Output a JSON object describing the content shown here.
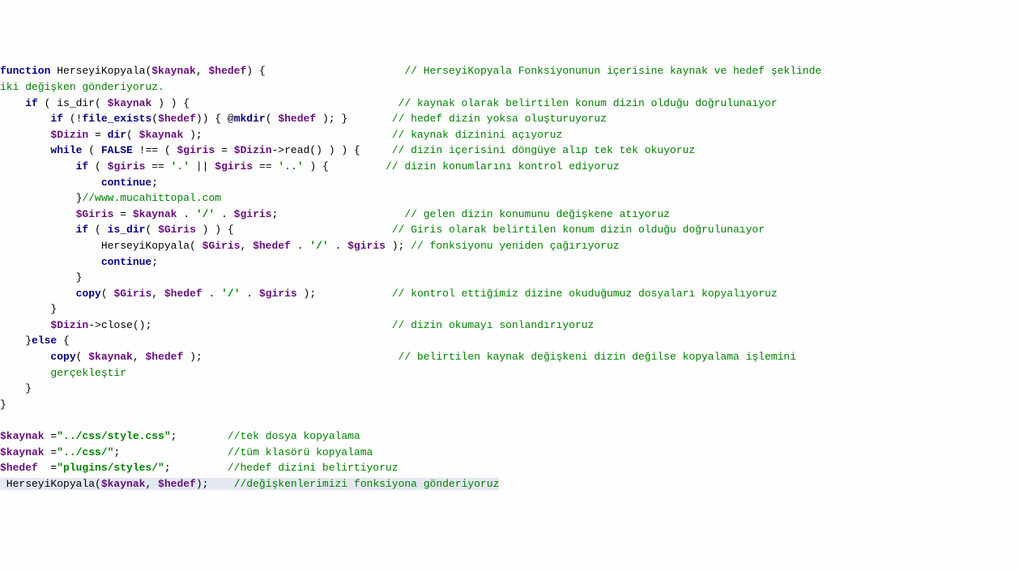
{
  "code": {
    "l1_a": "function",
    "l1_b": " HerseyiKopyala(",
    "l1_c": "$kaynak",
    "l1_d": ", ",
    "l1_e": "$hedef",
    "l1_f": ") {",
    "l1_pad": "                      ",
    "l1_com": "// HerseyiKopyala Fonksiyonunun içerisine kaynak ve hedef şeklinde",
    "l2_a": "iki değişken gönderiyoruz.",
    "l3_pad": "    ",
    "l3_a": "if",
    "l3_b": " ( is_dir( ",
    "l3_c": "$kaynak",
    "l3_d": " ) ) {",
    "l3_pad2": "                                 ",
    "l3_com": "// kaynak olarak belirtilen konum dizin olduğu doğrulunaıyor",
    "l4_pad": "        ",
    "l4_a": "if",
    "l4_b": " (!",
    "l4_c": "file_exists",
    "l4_d": "(",
    "l4_e": "$hedef",
    "l4_f": ")) { @",
    "l4_g": "mkdir",
    "l4_h": "( ",
    "l4_i": "$hedef",
    "l4_j": " ); }",
    "l4_pad2": "       ",
    "l4_com": "// hedef dizin yoksa oluşturuyoruz",
    "l5_pad": "        ",
    "l5_a": "$Dizin",
    "l5_b": " = ",
    "l5_c": "dir",
    "l5_d": "( ",
    "l5_e": "$kaynak",
    "l5_f": " );",
    "l5_pad2": "                              ",
    "l5_com": "// kaynak dizinini açıyoruz",
    "l6_pad": "        ",
    "l6_a": "while",
    "l6_b": " ( ",
    "l6_c": "FALSE",
    "l6_d": " !== ( ",
    "l6_e": "$giris",
    "l6_f": " = ",
    "l6_g": "$Dizin",
    "l6_h": "->read() ) ) {",
    "l6_pad2": "     ",
    "l6_com": "// dizin içerisini döngüye alıp tek tek okuyoruz",
    "l7_pad": "            ",
    "l7_a": "if",
    "l7_b": " ( ",
    "l7_c": "$giris",
    "l7_d": " == ",
    "l7_e": "'.'",
    "l7_f": " || ",
    "l7_g": "$giris",
    "l7_h": " == ",
    "l7_i": "'..'",
    "l7_j": " ) {",
    "l7_pad2": "         ",
    "l7_com": "// dizin konumlarını kontrol ediyoruz",
    "l8_pad": "                ",
    "l8_a": "continue",
    "l8_b": ";",
    "l9_pad": "            ",
    "l9_a": "}",
    "l9_com": "//www.mucahittopal.com",
    "l10_pad": "            ",
    "l10_a": "$Giris",
    "l10_b": " = ",
    "l10_c": "$kaynak",
    "l10_d": " . ",
    "l10_e": "'/'",
    "l10_f": " . ",
    "l10_g": "$giris",
    "l10_h": ";",
    "l10_pad2": "                    ",
    "l10_com": "// gelen dizin konumunu değişkene atıyoruz",
    "l11_pad": "            ",
    "l11_a": "if",
    "l11_b": " ( ",
    "l11_c": "is_dir",
    "l11_d": "( ",
    "l11_e": "$Giris",
    "l11_f": " ) ) {",
    "l11_pad2": "                         ",
    "l11_com": "// Giris olarak belirtilen konum dizin olduğu doğrulunaıyor",
    "l12_pad": "                ",
    "l12_a": "HerseyiKopyala( ",
    "l12_b": "$Giris",
    "l12_c": ", ",
    "l12_d": "$hedef",
    "l12_e": " . ",
    "l12_f": "'/'",
    "l12_g": " . ",
    "l12_h": "$giris",
    "l12_i": " ); ",
    "l12_com": "// fonksiyonu yeniden çağırıyoruz",
    "l13_pad": "                ",
    "l13_a": "continue",
    "l13_b": ";",
    "l14_pad": "            ",
    "l14_a": "}",
    "l15_pad": "            ",
    "l15_a": "copy",
    "l15_b": "( ",
    "l15_c": "$Giris",
    "l15_d": ", ",
    "l15_e": "$hedef",
    "l15_f": " . ",
    "l15_g": "'/'",
    "l15_h": " . ",
    "l15_i": "$giris",
    "l15_j": " );",
    "l15_pad2": "            ",
    "l15_com": "// kontrol ettiğimiz dizine okuduğumuz dosyaları kopyalıyoruz",
    "l16_pad": "        ",
    "l16_a": "}",
    "l17_pad": "        ",
    "l17_a": "$Dizin",
    "l17_b": "->close();",
    "l17_pad2": "                                      ",
    "l17_com": "// dizin okumayı sonlandırıyoruz",
    "l18_pad": "    ",
    "l18_a": "}",
    "l18_b": "else",
    "l18_c": " {",
    "l19_pad": "        ",
    "l19_a": "copy",
    "l19_b": "( ",
    "l19_c": "$kaynak",
    "l19_d": ", ",
    "l19_e": "$hedef",
    "l19_f": " );",
    "l19_pad2": "                               ",
    "l19_com": "// belirtilen kaynak değişkeni dizin değilse kopyalama işlemini",
    "l20_pad": "        ",
    "l20_a": "gerçekleştir",
    "l21_pad": "    ",
    "l21_a": "}",
    "l22_a": "}",
    "blank": "",
    "l24_a": "$kaynak",
    "l24_b": " =",
    "l24_c": "\"../css/style.css\"",
    "l24_d": ";",
    "l24_pad": "        ",
    "l24_com": "//tek dosya kopyalama",
    "l25_a": "$kaynak",
    "l25_b": " =",
    "l25_c": "\"../css/\"",
    "l25_d": ";",
    "l25_pad": "                 ",
    "l25_com": "//tüm klasörü kopyalama",
    "l26_a": "$hedef",
    "l26_b": "  =",
    "l26_c": "\"plugins/styles/\"",
    "l26_d": ";",
    "l26_pad": "         ",
    "l26_com": "//hedef dizini belirtiyoruz",
    "l27_a": " HerseyiKopyala(",
    "l27_b": "$kaynak",
    "l27_c": ", ",
    "l27_d": "$hedef",
    "l27_e": ");",
    "l27_pad": "    ",
    "l27_com": "//değişkenlerimizi fonksiyona gönderiyoruz"
  }
}
